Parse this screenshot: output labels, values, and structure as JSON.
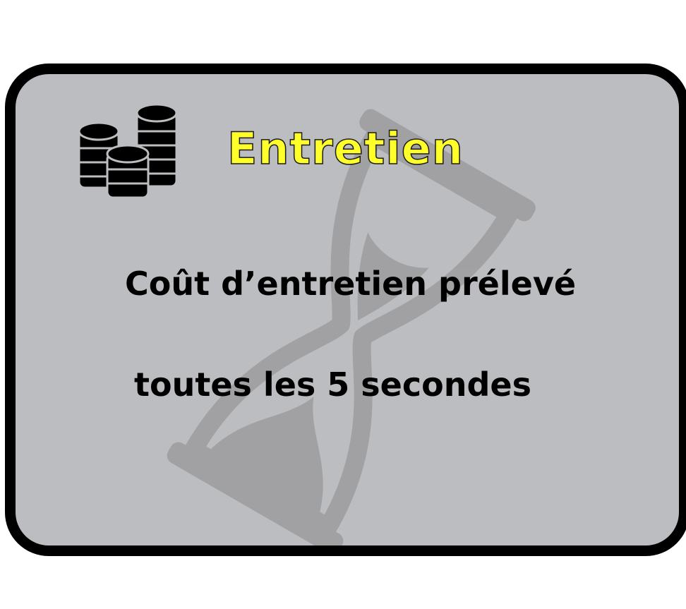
{
  "card": {
    "title": "Entretien",
    "description_line1": "Coût d’entretien prélevé",
    "description_line2": "toutes les 5 secondes",
    "background_color": "#bcbdc0",
    "border_color": "#000000",
    "title_color": "#ffff2a",
    "icons": {
      "top_left": "coin-stacks-icon",
      "watermark": "hourglass-icon"
    }
  }
}
